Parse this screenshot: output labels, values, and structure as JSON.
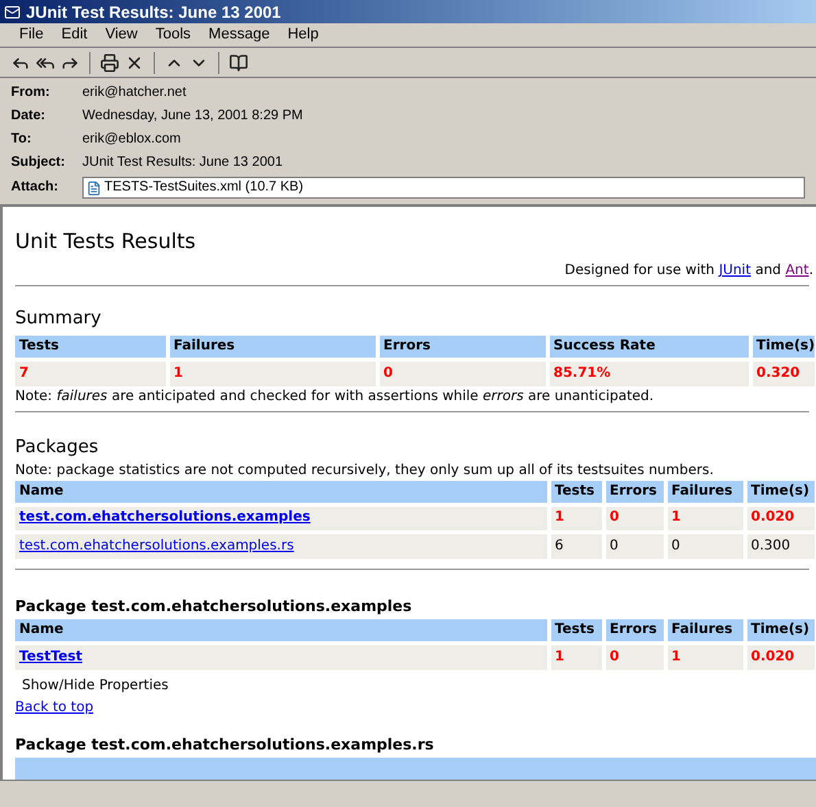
{
  "window": {
    "title": "JUnit Test Results: June 13 2001"
  },
  "menu": [
    "File",
    "Edit",
    "View",
    "Tools",
    "Message",
    "Help"
  ],
  "header_fields": [
    {
      "label": "From:",
      "value": "erik@hatcher.net"
    },
    {
      "label": "Date:",
      "value": "Wednesday, June 13, 2001 8:29 PM"
    },
    {
      "label": "To:",
      "value": "erik@eblox.com"
    },
    {
      "label": "Subject:",
      "value": "JUnit Test Results: June 13 2001"
    }
  ],
  "attachment": {
    "label": "Attach:",
    "file": "TESTS-TestSuites.xml (10.7 KB)"
  },
  "report": {
    "title": "Unit Tests Results",
    "credit": {
      "before": "Designed for use with",
      "links": [
        {
          "text": "JUnit",
          "visited": false
        },
        {
          "text": "Ant",
          "visited": true
        }
      ],
      "between": "and",
      "after": "."
    },
    "summary": {
      "heading": "Summary",
      "columns": [
        "Tests",
        "Failures",
        "Errors",
        "Success Rate",
        "Time(s)"
      ],
      "rows": [
        {
          "cells": [
            "7",
            "1",
            "0",
            "85.71%",
            "0.320"
          ],
          "failed": true
        }
      ],
      "note": "Note: *failures* are anticipated and checked for with assertions while *errors* are unanticipated."
    },
    "packages": {
      "heading": "Packages",
      "note": "Note: package statistics are not computed recursively, they only sum up all of its testsuites numbers.",
      "columns": [
        "Name",
        "Tests",
        "Errors",
        "Failures",
        "Time(s)"
      ],
      "rows": [
        {
          "cells": [
            "test.com.ehatchersolutions.examples",
            "1",
            "0",
            "1",
            "0.020"
          ],
          "failed": true
        },
        {
          "cells": [
            "test.com.ehatchersolutions.examples.rs",
            "6",
            "0",
            "0",
            "0.300"
          ],
          "failed": false
        }
      ]
    },
    "package_sections": [
      {
        "heading": "Package test.com.ehatchersolutions.examples",
        "columns": [
          "Name",
          "Tests",
          "Errors",
          "Failures",
          "Time(s)"
        ],
        "rows": [
          {
            "cells": [
              "TestTest",
              "1",
              "0",
              "1",
              "0.020"
            ],
            "failed": true
          }
        ],
        "properties_toggle": "Show/Hide Properties",
        "back_link": "Back to top"
      },
      {
        "heading": "Package test.com.ehatchersolutions.examples.rs"
      }
    ]
  }
}
